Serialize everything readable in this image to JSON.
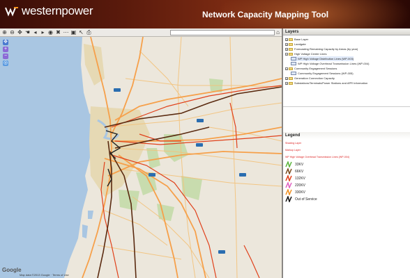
{
  "header": {
    "brand": "westernpower",
    "title": "Network Capacity Mapping Tool"
  },
  "toolbar": {
    "icons": [
      "zoom-in-icon",
      "zoom-out-icon",
      "pan-icon",
      "hand-icon",
      "back-icon",
      "forward-icon",
      "identify-icon",
      "clear-icon",
      "measure-icon",
      "full-extent-icon",
      "select-icon",
      "print-icon"
    ],
    "search_placeholder": ""
  },
  "map": {
    "attribution": "Google",
    "terms": "Map data ©2013 Google · Terms of Use"
  },
  "layers": {
    "title": "Layers",
    "items": [
      {
        "label": "Base Layer",
        "level": 0,
        "type": "folder"
      },
      {
        "label": "Landgate",
        "level": 0,
        "type": "folder"
      },
      {
        "label": "Forecasting Remaining Capacity by Areas (by year)",
        "level": 0,
        "type": "folder"
      },
      {
        "label": "High Voltage Center Lines",
        "level": 0,
        "type": "folder-open"
      },
      {
        "label": "WP High Voltage Distribution Lines (WP-003)",
        "level": 1,
        "type": "layer",
        "selected": true
      },
      {
        "label": "WP High Voltage Overhead Transmission Lines (WP-004)",
        "level": 1,
        "type": "layer"
      },
      {
        "label": "Community Engagement Sessions",
        "level": 0,
        "type": "folder-open"
      },
      {
        "label": "Community Engagement Sessions (WP-005)",
        "level": 1,
        "type": "layer"
      },
      {
        "label": "Generation Connection Capacity",
        "level": 0,
        "type": "folder"
      },
      {
        "label": "Substations/Terminals/Power Stations and APR Information",
        "level": 0,
        "type": "folder"
      }
    ]
  },
  "legend": {
    "title": "Legend",
    "captions": [
      "Shading Layer",
      "Markup Layer",
      "WP High Voltage Overhead Transmission Lines (WP-004)"
    ],
    "items": [
      {
        "label": "33KV",
        "color": "#5ab43a"
      },
      {
        "label": "66KV",
        "color": "#7a4a1c"
      },
      {
        "label": "132KV",
        "color": "#e0401a"
      },
      {
        "label": "220KV",
        "color": "#e060c0"
      },
      {
        "label": "330KV",
        "color": "#f09020"
      },
      {
        "label": "Out of Service",
        "color": "#111111"
      }
    ]
  },
  "colors": {
    "header_bg": "#5a1a0c",
    "major_road": "#f6a04a",
    "line_132kv": "#e0401a",
    "line_330kv": "#5a2a10",
    "ocean": "#a9c6e2",
    "park": "#c8dcae",
    "urban": "#e6d9b4"
  }
}
